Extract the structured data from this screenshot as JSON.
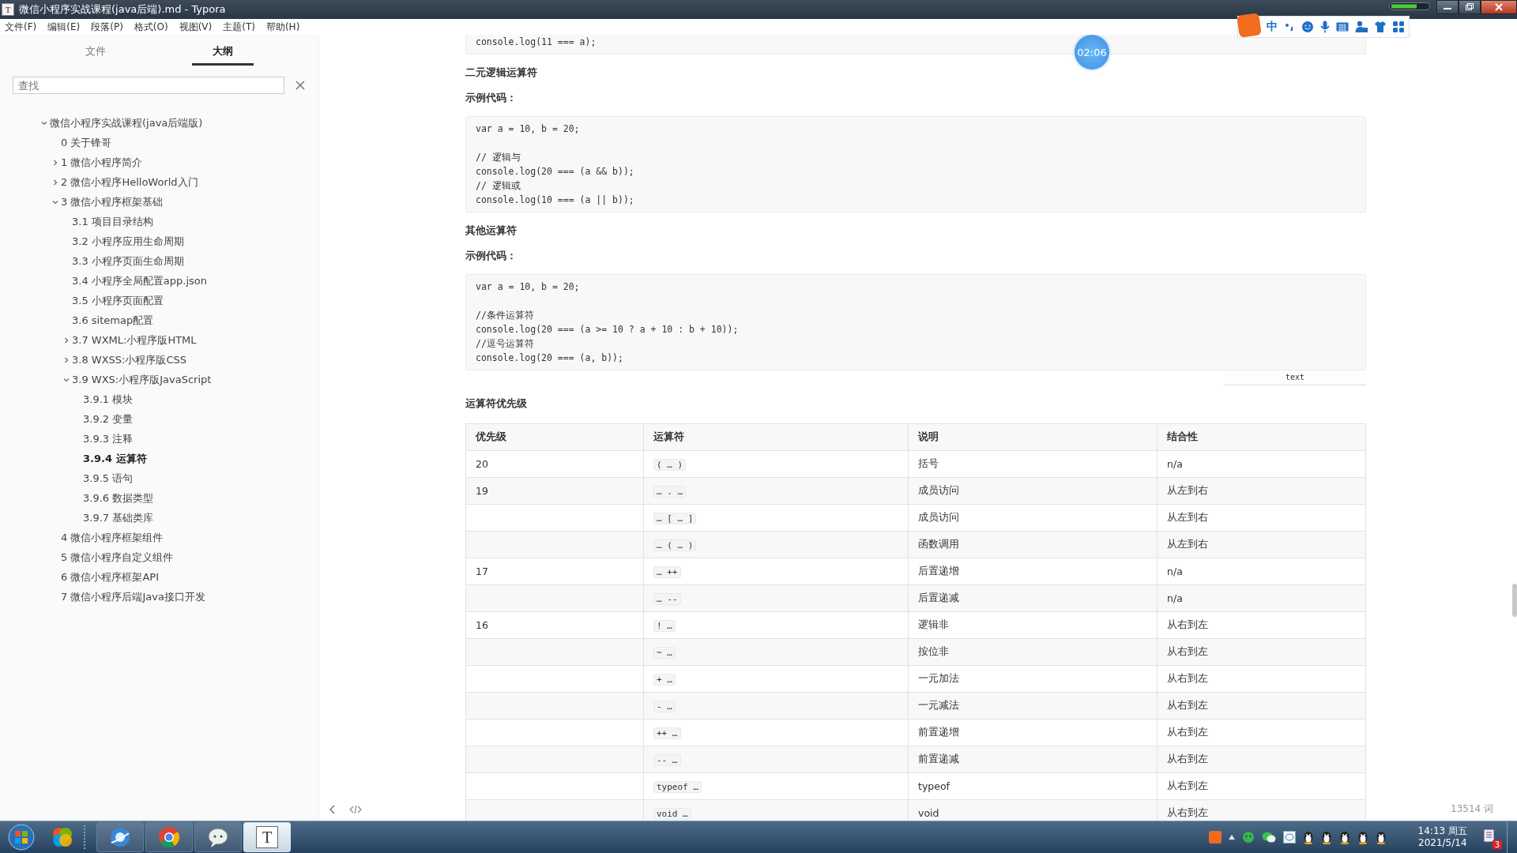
{
  "window": {
    "title": "微信小程序实战课程(java后端).md - Typora",
    "icon_label": "T"
  },
  "menu": [
    "文件(F)",
    "编辑(E)",
    "段落(P)",
    "格式(O)",
    "视图(V)",
    "主题(T)",
    "帮助(H)"
  ],
  "sidebar": {
    "tabs": [
      {
        "label": "文件",
        "selected": false
      },
      {
        "label": "大纲",
        "selected": true
      }
    ],
    "search": {
      "placeholder": "查找"
    },
    "outline": [
      {
        "label": "微信小程序实战课程(java后端版)",
        "selected": false,
        "expanded": true,
        "children": [
          {
            "label": "0 关于锋哥",
            "selected": false
          },
          {
            "label": "1 微信小程序简介",
            "selected": false,
            "expanded": false
          },
          {
            "label": "2 微信小程序HelloWorld入门",
            "selected": false,
            "expanded": false
          },
          {
            "label": "3 微信小程序框架基础",
            "selected": false,
            "expanded": true,
            "children": [
              {
                "label": "3.1 项目目录结构",
                "selected": false
              },
              {
                "label": "3.2 小程序应用生命周期",
                "selected": false
              },
              {
                "label": "3.3 小程序页面生命周期",
                "selected": false
              },
              {
                "label": "3.4 小程序全局配置app.json",
                "selected": false
              },
              {
                "label": "3.5 小程序页面配置",
                "selected": false
              },
              {
                "label": "3.6 sitemap配置",
                "selected": false
              },
              {
                "label": "3.7 WXML:小程序版HTML",
                "selected": false,
                "expanded": false
              },
              {
                "label": "3.8 WXSS:小程序版CSS",
                "selected": false,
                "expanded": false
              },
              {
                "label": "3.9 WXS:小程序版JavaScript",
                "selected": false,
                "expanded": true,
                "children": [
                  {
                    "label": "3.9.1 模块",
                    "selected": false
                  },
                  {
                    "label": "3.9.2 变量",
                    "selected": false
                  },
                  {
                    "label": "3.9.3 注释",
                    "selected": false
                  },
                  {
                    "label": "3.9.4 运算符",
                    "selected": true
                  },
                  {
                    "label": "3.9.5 语句",
                    "selected": false
                  },
                  {
                    "label": "3.9.6 数据类型",
                    "selected": false
                  },
                  {
                    "label": "3.9.7 基础类库",
                    "selected": false
                  }
                ]
              }
            ]
          },
          {
            "label": "4 微信小程序框架组件",
            "selected": false
          },
          {
            "label": "5 微信小程序自定义组件",
            "selected": false
          },
          {
            "label": "6 微信小程序框架API",
            "selected": false
          },
          {
            "label": "7 微信小程序后端Java接口开发",
            "selected": false
          }
        ]
      }
    ]
  },
  "document": [
    {
      "kind": "code",
      "groups": [
        [
          "console.log(11 === a);"
        ]
      ]
    },
    {
      "kind": "heading",
      "text": "二元逻辑运算符"
    },
    {
      "kind": "label",
      "text": "示例代码："
    },
    {
      "kind": "code",
      "groups": [
        [
          "var a = 10, b = 20;"
        ],
        [
          "// 逻辑与",
          "console.log(20 === (a && b));",
          "// 逻辑或",
          "console.log(10 === (a || b));"
        ]
      ]
    },
    {
      "kind": "heading",
      "text": "其他运算符"
    },
    {
      "kind": "label",
      "text": "示例代码："
    },
    {
      "kind": "code",
      "groups": [
        [
          "var a = 10, b = 20;"
        ],
        [
          "//条件运算符",
          "console.log(20 === (a >= 10 ? a + 10 : b + 10));",
          "//逗号运算符",
          "console.log(20 === (a, b));"
        ]
      ],
      "language": "text"
    },
    {
      "kind": "heading",
      "text": "运算符优先级"
    },
    {
      "kind": "table",
      "columns": [
        "优先级",
        "运算符",
        "说明",
        "结合性"
      ],
      "rows": [
        [
          "20",
          "( … )",
          "括号",
          "n/a"
        ],
        [
          "19",
          "… . …",
          "成员访问",
          "从左到右"
        ],
        [
          "",
          "… [ … ]",
          "成员访问",
          "从左到右"
        ],
        [
          "",
          "… ( … )",
          "函数调用",
          "从左到右"
        ],
        [
          "17",
          "… ++",
          "后置递增",
          "n/a"
        ],
        [
          "",
          "… --",
          "后置递减",
          "n/a"
        ],
        [
          "16",
          "! …",
          "逻辑非",
          "从右到左"
        ],
        [
          "",
          "~ …",
          "按位非",
          "从右到左"
        ],
        [
          "",
          "+ …",
          "一元加法",
          "从右到左"
        ],
        [
          "",
          "- …",
          "一元减法",
          "从右到左"
        ],
        [
          "",
          "++ …",
          "前置递增",
          "从右到左"
        ],
        [
          "",
          "-- …",
          "前置递减",
          "从右到左"
        ],
        [
          "",
          "typeof …",
          "typeof",
          "从右到左"
        ],
        [
          "",
          "void …",
          "void",
          "从右到左"
        ]
      ]
    }
  ],
  "word_count": "13514 词",
  "timer": "02:06",
  "ime": {
    "mode": "中"
  },
  "taskbar": {
    "apps": [
      {
        "kind": "browser",
        "selected": false
      },
      {
        "kind": "chrome",
        "selected": false
      },
      {
        "kind": "chat",
        "selected": false
      },
      {
        "kind": "typora",
        "label": "T",
        "selected": true
      }
    ],
    "clock": {
      "time": "14:13 周五",
      "date": "2021/5/14"
    },
    "notifications": "3"
  }
}
